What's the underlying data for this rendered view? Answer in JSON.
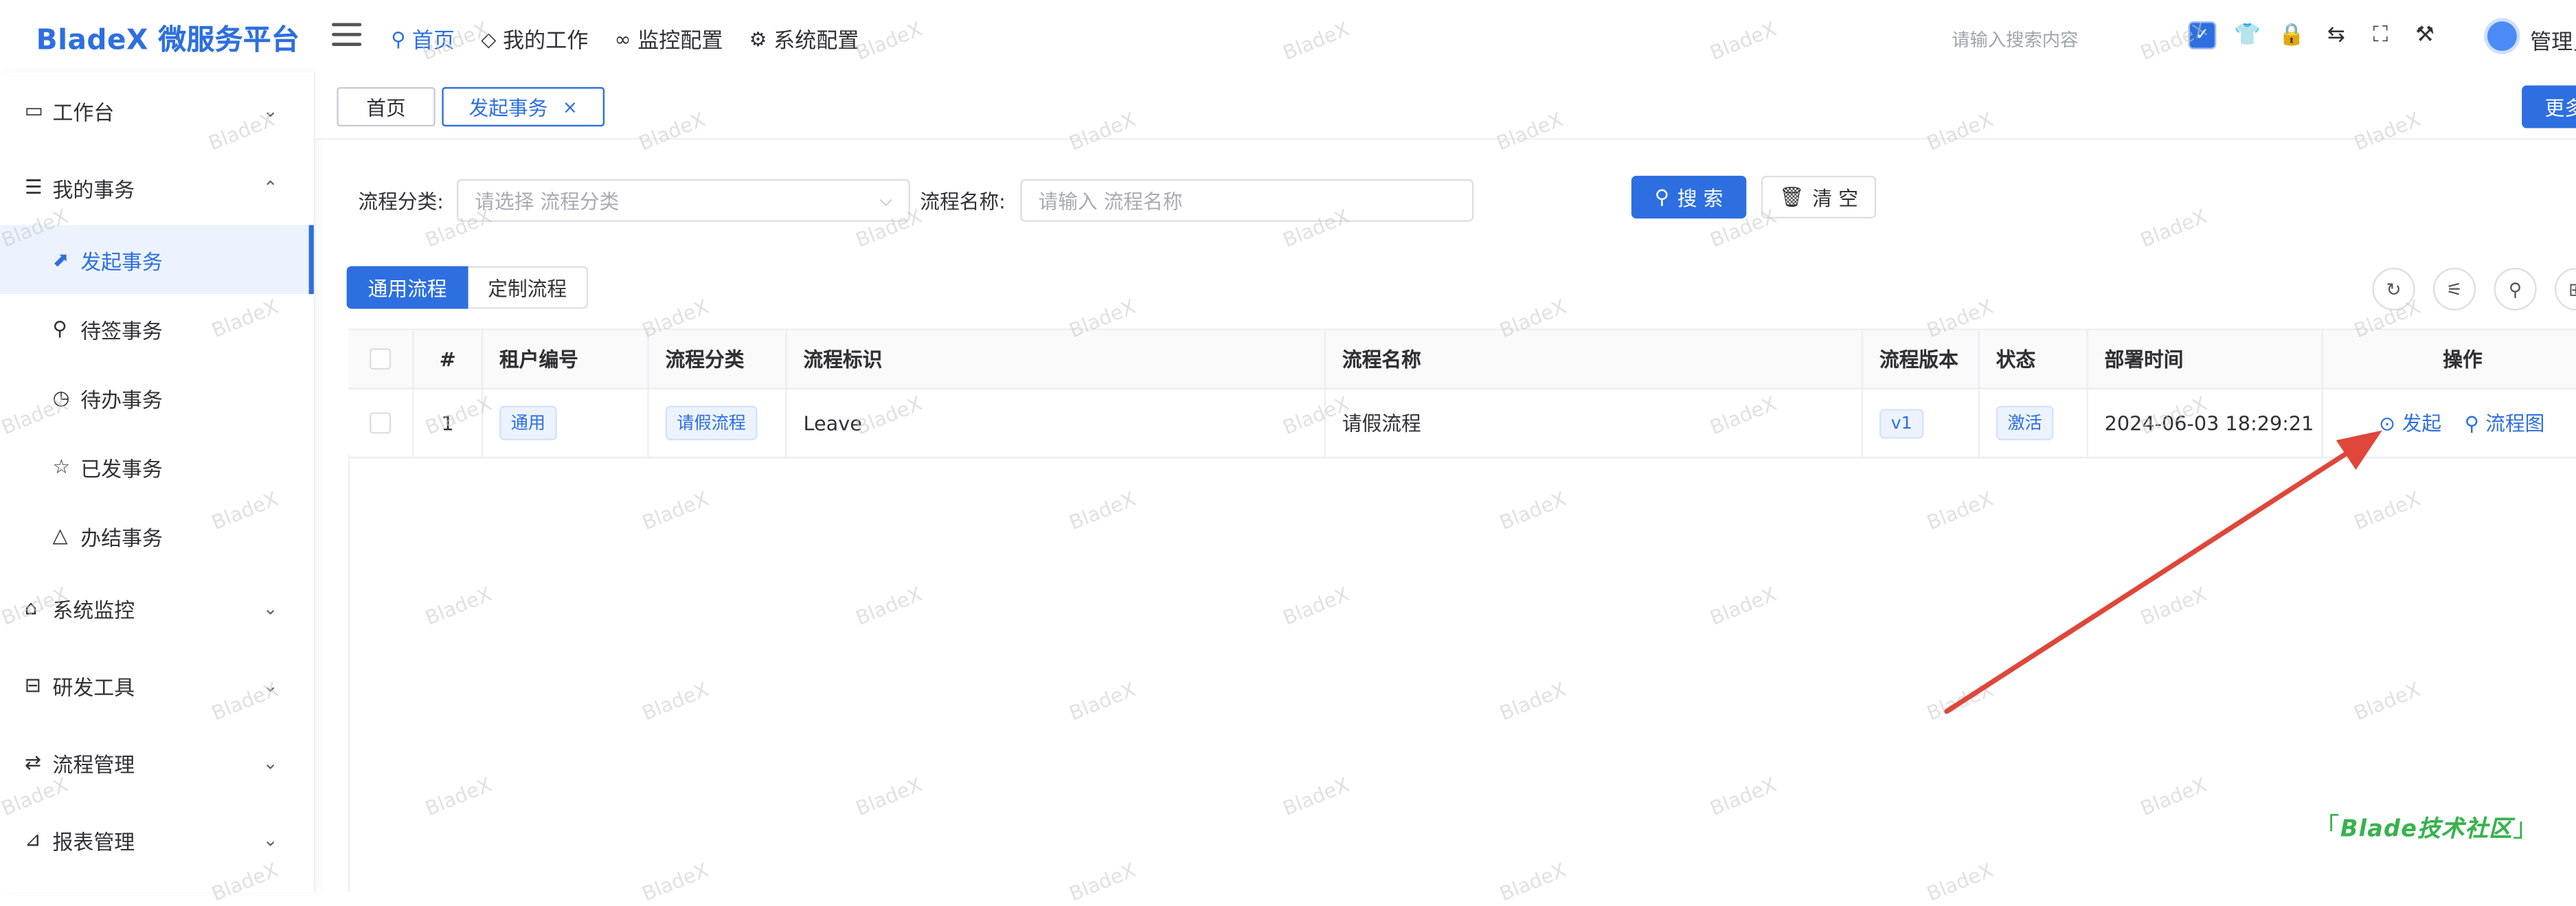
{
  "app": {
    "logo": "BladeX 微服务平台"
  },
  "topnav": [
    {
      "icon": "⚲",
      "label": "首页"
    },
    {
      "icon": "◇",
      "label": "我的工作"
    },
    {
      "icon": "∞",
      "label": "监控配置"
    },
    {
      "icon": "⚙",
      "label": "系统配置"
    }
  ],
  "header": {
    "search_placeholder": "请输入搜索内容",
    "user": "管理员"
  },
  "sidebar": [
    {
      "icon": "▭",
      "label": "工作台",
      "arrow": "⌄"
    },
    {
      "icon": "☰",
      "label": "我的事务",
      "arrow": "⌃"
    },
    {
      "icon": "⬈",
      "label": "发起事务"
    },
    {
      "icon": "⚲",
      "label": "待签事务"
    },
    {
      "icon": "◷",
      "label": "待办事务"
    },
    {
      "icon": "☆",
      "label": "已发事务"
    },
    {
      "icon": "△",
      "label": "办结事务"
    },
    {
      "icon": "⌂",
      "label": "系统监控",
      "arrow": "⌄"
    },
    {
      "icon": "⊟",
      "label": "研发工具",
      "arrow": "⌄"
    },
    {
      "icon": "⇄",
      "label": "流程管理",
      "arrow": "⌄"
    },
    {
      "icon": "⊿",
      "label": "报表管理",
      "arrow": "⌄"
    }
  ],
  "tabs": {
    "home": "首页",
    "current": "发起事务",
    "close": "×",
    "more": "更多"
  },
  "filter": {
    "category_label": "流程分类:",
    "category_placeholder": "请选择 流程分类",
    "name_label": "流程名称:",
    "name_placeholder": "请输入 流程名称",
    "search_btn": "搜 索",
    "clear_btn": "清 空"
  },
  "segments": [
    "通用流程",
    "定制流程"
  ],
  "table": {
    "headers": [
      "#",
      "租户编号",
      "流程分类",
      "流程标识",
      "流程名称",
      "流程版本",
      "状态",
      "部署时间",
      "操作"
    ],
    "rows": [
      {
        "index": "1",
        "tenant": "通用",
        "category": "请假流程",
        "key": "Leave",
        "name": "请假流程",
        "version": "v1",
        "status": "激活",
        "deploy_time": "2024-06-03 18:29:21",
        "actions": [
          "发起",
          "流程图"
        ]
      }
    ]
  },
  "watermark": "BladeX",
  "community": "Blade技术社区",
  "colors": {
    "primary": "#2d6fe0",
    "arrow": "#e0463a",
    "community": "#37b24d"
  }
}
